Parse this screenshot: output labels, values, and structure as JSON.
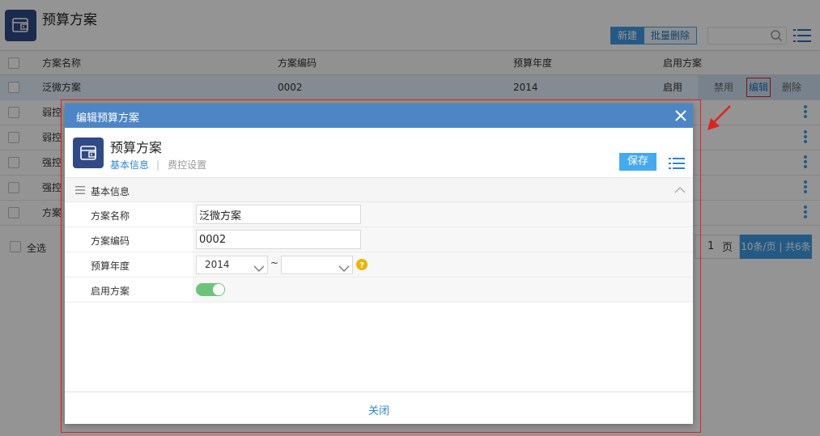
{
  "page": {
    "title": "预算方案",
    "buttons": {
      "new": "新建",
      "batch_delete": "批量删除"
    },
    "search": {
      "placeholder": ""
    },
    "table": {
      "headers": [
        "方案名称",
        "方案编码",
        "预算年度",
        "启用方案"
      ],
      "rows": [
        {
          "name": "泛微方案",
          "code": "0002",
          "year": "2014",
          "status": "启用"
        },
        {
          "name": "弱控"
        },
        {
          "name": "弱控"
        },
        {
          "name": "强控"
        },
        {
          "name": "强控"
        },
        {
          "name": "方案"
        }
      ],
      "row_actions": {
        "disable": "禁用",
        "edit": "编辑",
        "delete": "删除"
      }
    },
    "footer": {
      "select_all": "全选",
      "page_num": "1",
      "page_unit": "页",
      "page_size": "10条/页 | 共6条"
    }
  },
  "modal": {
    "title": "编辑预算方案",
    "heading": "预算方案",
    "tabs": [
      {
        "label": "基本信息",
        "active": true
      },
      {
        "label": "费控设置",
        "active": false
      }
    ],
    "save_label": "保存",
    "section_title": "基本信息",
    "fields": {
      "name": {
        "label": "方案名称",
        "value": "泛微方案"
      },
      "code": {
        "label": "方案编码",
        "value": "0002"
      },
      "year": {
        "label": "预算年度",
        "from": "2014",
        "to": "",
        "separator": "~"
      },
      "enable": {
        "label": "启用方案",
        "value": true
      }
    },
    "close_label": "关闭"
  },
  "colors": {
    "accent": "#3d9be6",
    "header_blue": "#4d86c6",
    "logo": "#2f4a86",
    "toggle_on": "#6cc47a",
    "highlight": "#e02020"
  }
}
